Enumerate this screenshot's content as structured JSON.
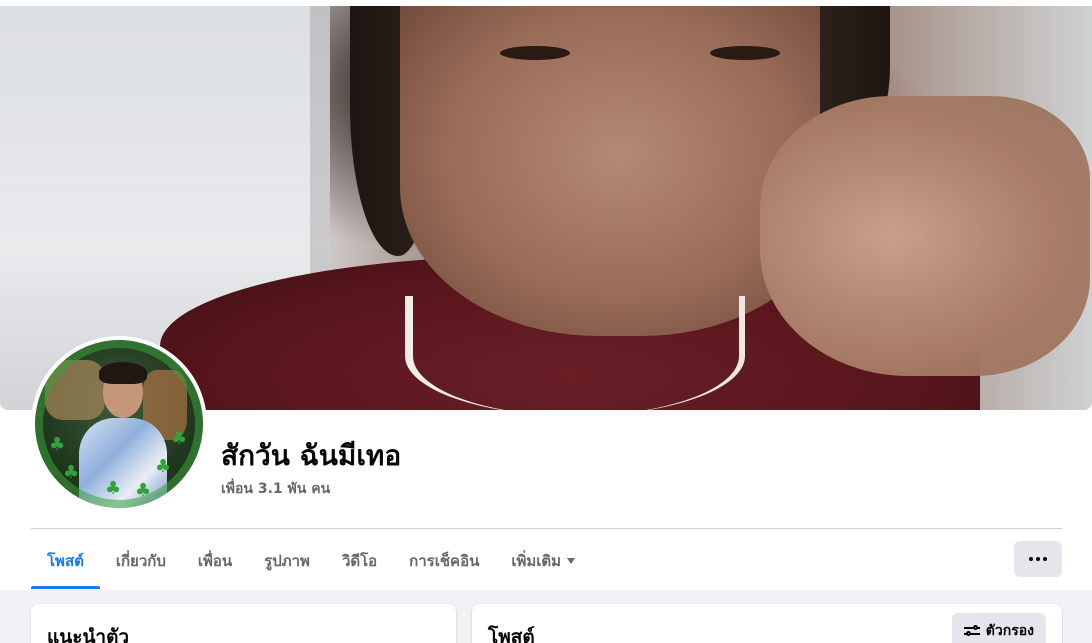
{
  "profile": {
    "name": "สักวัน ฉันมีเทอ",
    "friends_text": "เพื่อน 3.1 พัน คน"
  },
  "tabs": [
    {
      "label": "โพสต์",
      "active": true
    },
    {
      "label": "เกี่ยวกับ",
      "active": false
    },
    {
      "label": "เพื่อน",
      "active": false
    },
    {
      "label": "รูปภาพ",
      "active": false
    },
    {
      "label": "วิดีโอ",
      "active": false
    },
    {
      "label": "การเช็คอิน",
      "active": false
    },
    {
      "label": "เพิ่มเติม",
      "active": false,
      "has_dropdown": true
    }
  ],
  "more_button": {
    "icon": "more-horizontal-icon"
  },
  "intro_card": {
    "title": "แนะนำตัว"
  },
  "posts_card": {
    "title": "โพสต์",
    "filter_label": "ตัวกรอง",
    "filter_icon": "filter-sliders-icon"
  },
  "colors": {
    "accent": "#1877f2",
    "secondary_text": "#65676b",
    "page_background": "#f0f2f5",
    "button_background": "#e4e6eb"
  }
}
